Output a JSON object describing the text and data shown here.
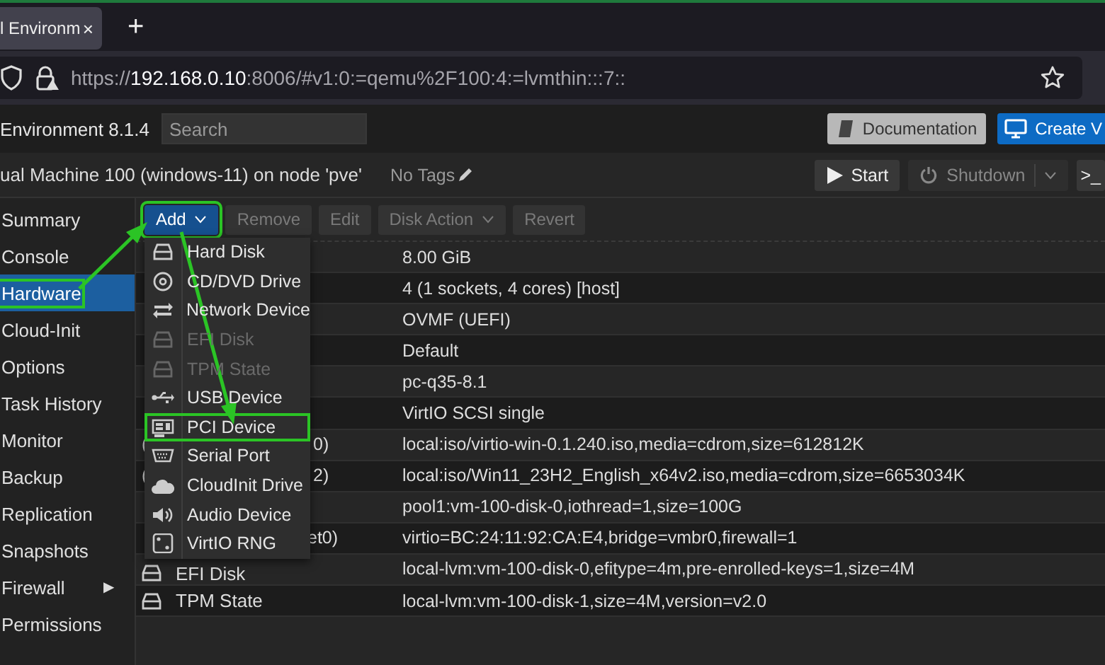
{
  "browser": {
    "tab": {
      "title": "l Environm",
      "close": "×"
    },
    "new_tab": "+",
    "url": {
      "scheme": "https://",
      "host": "192.168.0.10",
      "rest": ":8006/#v1:0:=qemu%2F100:4:=lvmthin:::7::"
    }
  },
  "header": {
    "product": "Environment 8.1.4",
    "search": {
      "placeholder": "Search"
    },
    "buttons": [
      {
        "label": "Documentation",
        "kind": "doc"
      },
      {
        "label": "Create V",
        "kind": "create"
      }
    ]
  },
  "vm_bar": {
    "title": "ual Machine 100 (windows-11) on node 'pve'",
    "tags": "No Tags",
    "buttons": [
      {
        "label": "Start",
        "kind": "start",
        "disabled": false
      },
      {
        "label": "Shutdown",
        "kind": "shutdown",
        "disabled": true
      },
      {
        "label": ">_",
        "kind": "console",
        "disabled": false
      }
    ]
  },
  "nav": [
    {
      "label": "Summary",
      "selected": false,
      "highlighted": false
    },
    {
      "label": "Console",
      "selected": false,
      "highlighted": false
    },
    {
      "label": "Hardware",
      "selected": true,
      "highlighted": true
    },
    {
      "label": "Cloud-Init",
      "selected": false,
      "highlighted": false
    },
    {
      "label": "Options",
      "selected": false,
      "highlighted": false
    },
    {
      "label": "Task History",
      "selected": false,
      "highlighted": false
    },
    {
      "label": "Monitor",
      "selected": false,
      "highlighted": false
    },
    {
      "label": "Backup",
      "selected": false,
      "highlighted": false
    },
    {
      "label": "Replication",
      "selected": false,
      "highlighted": false
    },
    {
      "label": "Snapshots",
      "selected": false,
      "highlighted": false
    },
    {
      "label": "Firewall",
      "selected": false,
      "highlighted": false,
      "arrow": "▶"
    },
    {
      "label": "Permissions",
      "selected": false,
      "highlighted": false
    }
  ],
  "toolbar": [
    {
      "label": "Add",
      "kind": "primary",
      "dropdown": true,
      "disabled": false,
      "highlighted": true
    },
    {
      "label": "Remove",
      "kind": "plain",
      "dropdown": false,
      "disabled": true,
      "highlighted": false
    },
    {
      "label": "Edit",
      "kind": "plain",
      "dropdown": false,
      "disabled": true,
      "highlighted": false
    },
    {
      "label": "Disk Action",
      "kind": "plain",
      "dropdown": true,
      "disabled": true,
      "highlighted": false
    },
    {
      "label": "Revert",
      "kind": "plain",
      "dropdown": false,
      "disabled": true,
      "highlighted": false
    }
  ],
  "add_menu": [
    {
      "label": "Hard Disk",
      "kind": "disk",
      "disabled": false,
      "highlighted": false
    },
    {
      "label": "CD/DVD Drive",
      "kind": "cdrom",
      "disabled": false,
      "highlighted": false
    },
    {
      "label": "Network Device",
      "kind": "network",
      "disabled": false,
      "highlighted": false
    },
    {
      "label": "EFI Disk",
      "kind": "disk",
      "disabled": true,
      "highlighted": false
    },
    {
      "label": "TPM State",
      "kind": "disk",
      "disabled": true,
      "highlighted": false
    },
    {
      "label": "USB Device",
      "kind": "usb",
      "disabled": false,
      "highlighted": false
    },
    {
      "label": "PCI Device",
      "kind": "pci",
      "disabled": false,
      "highlighted": true
    },
    {
      "label": "Serial Port",
      "kind": "serial",
      "disabled": false,
      "highlighted": false
    },
    {
      "label": "CloudInit Drive",
      "kind": "cloud",
      "disabled": false,
      "highlighted": false
    },
    {
      "label": "Audio Device",
      "kind": "audio",
      "disabled": false,
      "highlighted": false
    },
    {
      "label": "VirtIO RNG",
      "kind": "rng",
      "disabled": false,
      "highlighted": false
    }
  ],
  "rows": [
    {
      "value": "8.00 GiB"
    },
    {
      "value": "4 (1 sockets, 4 cores) [host]"
    },
    {
      "value": "OVMF (UEFI)"
    },
    {
      "value": "Default"
    },
    {
      "value": "pc-q35-8.1"
    },
    {
      "value": "VirtIO SCSI single"
    },
    {
      "lead": "(",
      "tail": "0)",
      "value": "local:iso/virtio-win-0.1.240.iso,media=cdrom,size=612812K"
    },
    {
      "lead": "(",
      "tail": "2)",
      "value": "local:iso/Win11_23H2_English_x64v2.iso,media=cdrom,size=6653034K"
    },
    {
      "value": "pool1:vm-100-disk-0,iothread=1,size=100G"
    },
    {
      "tail": "et0)",
      "value": "virtio=BC:24:11:92:CA:E4,bridge=vmbr0,firewall=1"
    },
    {
      "label": "EFI Disk",
      "value": "local-lvm:vm-100-disk-0,efitype=4m,pre-enrolled-keys=1,size=4M"
    },
    {
      "label": "TPM State",
      "value": "local-lvm:vm-100-disk-1,size=4M,version=v2.0"
    }
  ]
}
